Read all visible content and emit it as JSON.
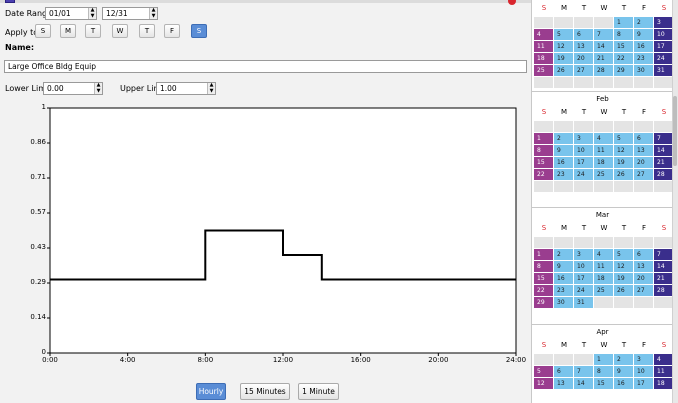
{
  "date_range": {
    "label": "Date Range:",
    "start": "01/01",
    "end": "12/31"
  },
  "apply_to": {
    "label": "Apply to:",
    "days": [
      {
        "label": "S",
        "selected": false
      },
      {
        "label": "M",
        "selected": false
      },
      {
        "label": "T",
        "selected": false
      },
      {
        "label": "W",
        "selected": false
      },
      {
        "label": "T",
        "selected": false
      },
      {
        "label": "F",
        "selected": false
      },
      {
        "label": "S",
        "selected": true
      }
    ]
  },
  "name": {
    "label": "Name:",
    "value": "Large Office Bldg Equip"
  },
  "limits": {
    "lower_label": "Lower Limit",
    "lower_value": "0.00",
    "upper_label": "Upper Limit",
    "upper_value": "1.00"
  },
  "chart_data": {
    "type": "line",
    "step": true,
    "y_ticks": [
      "1",
      "0.86",
      "0.71",
      "0.57",
      "0.43",
      "0.29",
      "0.14",
      "0"
    ],
    "x_ticks": [
      "0:00",
      "4:00",
      "8:00",
      "12:00",
      "16:00",
      "20:00",
      "24:00"
    ],
    "xlim": [
      0,
      24
    ],
    "ylim": [
      0,
      1
    ],
    "points": [
      [
        0,
        0.3
      ],
      [
        8,
        0.3
      ],
      [
        8,
        0.5
      ],
      [
        12,
        0.5
      ],
      [
        12,
        0.4
      ],
      [
        14,
        0.4
      ],
      [
        14,
        0.3
      ],
      [
        24,
        0.3
      ]
    ]
  },
  "timestep_buttons": [
    {
      "label": "Hourly",
      "selected": true
    },
    {
      "label": "15 Minutes",
      "selected": false
    },
    {
      "label": "1 Minute",
      "selected": false
    }
  ],
  "calendar": {
    "colors": {
      "weekday": "#79c4ec",
      "sunday": "#9a3d8f",
      "saturday": "#3a2e8c",
      "sunday_header": "#d9262e"
    },
    "day_headers": [
      "S",
      "M",
      "T",
      "W",
      "T",
      "F",
      "S"
    ],
    "months": [
      {
        "name": "",
        "rows": [
          [
            "",
            "",
            "",
            "",
            "1",
            "2",
            "3"
          ],
          [
            "4",
            "5",
            "6",
            "7",
            "8",
            "9",
            "10"
          ],
          [
            "11",
            "12",
            "13",
            "14",
            "15",
            "16",
            "17"
          ],
          [
            "18",
            "19",
            "20",
            "21",
            "22",
            "23",
            "24"
          ],
          [
            "25",
            "26",
            "27",
            "28",
            "29",
            "30",
            "31"
          ],
          [
            "",
            "",
            "",
            "",
            "",
            "",
            ""
          ]
        ]
      },
      {
        "name": "Feb",
        "rows": [
          [
            "",
            "",
            "",
            "",
            "",
            "",
            ""
          ],
          [
            "1",
            "2",
            "3",
            "4",
            "5",
            "6",
            "7"
          ],
          [
            "8",
            "9",
            "10",
            "11",
            "12",
            "13",
            "14"
          ],
          [
            "15",
            "16",
            "17",
            "18",
            "19",
            "20",
            "21"
          ],
          [
            "22",
            "23",
            "24",
            "25",
            "26",
            "27",
            "28"
          ],
          [
            "",
            "",
            "",
            "",
            "",
            "",
            ""
          ]
        ]
      },
      {
        "name": "Mar",
        "rows": [
          [
            "",
            "",
            "",
            "",
            "",
            "",
            ""
          ],
          [
            "1",
            "2",
            "3",
            "4",
            "5",
            "6",
            "7"
          ],
          [
            "8",
            "9",
            "10",
            "11",
            "12",
            "13",
            "14"
          ],
          [
            "15",
            "16",
            "17",
            "18",
            "19",
            "20",
            "21"
          ],
          [
            "22",
            "23",
            "24",
            "25",
            "26",
            "27",
            "28"
          ],
          [
            "29",
            "30",
            "31",
            "",
            "",
            "",
            ""
          ]
        ]
      },
      {
        "name": "Apr",
        "rows": [
          [
            "",
            "",
            "",
            "1",
            "2",
            "3",
            "4"
          ],
          [
            "5",
            "6",
            "7",
            "8",
            "9",
            "10",
            "11"
          ],
          [
            "12",
            "13",
            "14",
            "15",
            "16",
            "17",
            "18"
          ]
        ]
      }
    ]
  }
}
